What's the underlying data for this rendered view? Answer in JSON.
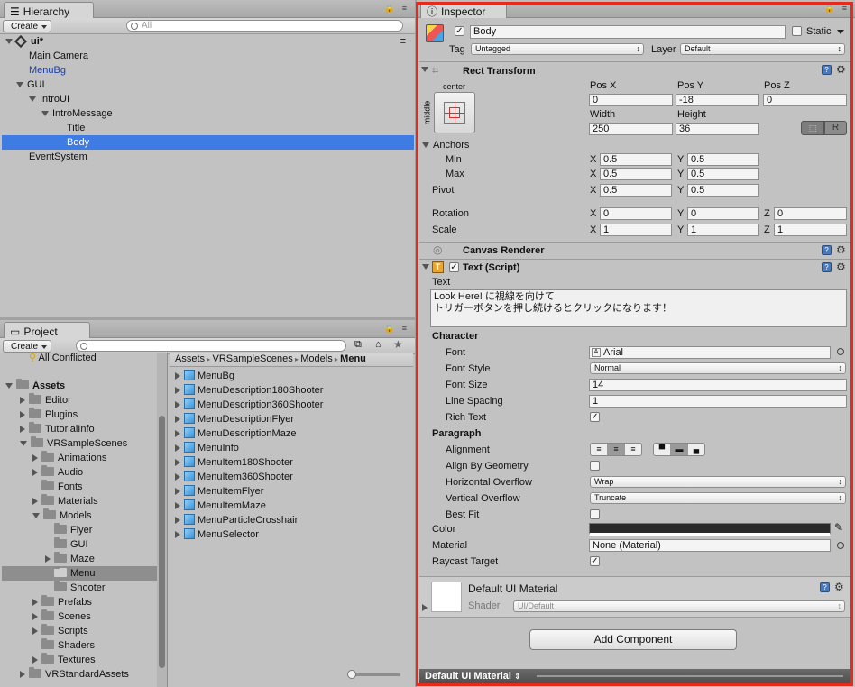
{
  "hierarchy": {
    "tab": "Hierarchy",
    "create_label": "Create",
    "search_placeholder": "All",
    "scene": "ui*",
    "items": [
      "Main Camera",
      "MenuBg",
      "GUI",
      "IntroUI",
      "IntroMessage",
      "Title",
      "Body",
      "EventSystem"
    ]
  },
  "project": {
    "tab": "Project",
    "create_label": "Create",
    "tree": [
      "All Conflicted",
      "Assets",
      "Editor",
      "Plugins",
      "TutorialInfo",
      "VRSampleScenes",
      "Animations",
      "Audio",
      "Fonts",
      "Materials",
      "Models",
      "Flyer",
      "GUI",
      "Maze",
      "Menu",
      "Shooter",
      "Prefabs",
      "Scenes",
      "Scripts",
      "Shaders",
      "Textures",
      "VRStandardAssets"
    ],
    "breadcrumb": [
      "Assets",
      "VRSampleScenes",
      "Models",
      "Menu"
    ],
    "assets": [
      "MenuBg",
      "MenuDescription180Shooter",
      "MenuDescription360Shooter",
      "MenuDescriptionFlyer",
      "MenuDescriptionMaze",
      "MenuInfo",
      "MenuItem180Shooter",
      "MenuItem360Shooter",
      "MenuItemFlyer",
      "MenuItemMaze",
      "MenuParticleCrosshair",
      "MenuSelector"
    ]
  },
  "inspector": {
    "tab": "Inspector",
    "object_name": "Body",
    "static_label": "Static",
    "tag_label": "Tag",
    "tag_value": "Untagged",
    "layer_label": "Layer",
    "layer_value": "Default",
    "rect": {
      "title": "Rect Transform",
      "anchor_top": "center",
      "anchor_side": "middle",
      "posx_label": "Pos X",
      "posy_label": "Pos Y",
      "posz_label": "Pos Z",
      "posx": "0",
      "posy": "-18",
      "posz": "0",
      "width_label": "Width",
      "height_label": "Height",
      "width": "250",
      "height": "36",
      "r_label": "R",
      "anchors_label": "Anchors",
      "min_label": "Min",
      "max_label": "Max",
      "min_x": "0.5",
      "min_y": "0.5",
      "max_x": "0.5",
      "max_y": "0.5",
      "pivot_label": "Pivot",
      "pivot_x": "0.5",
      "pivot_y": "0.5",
      "rotation_label": "Rotation",
      "rot_x": "0",
      "rot_y": "0",
      "rot_z": "0",
      "scale_label": "Scale",
      "scale_x": "1",
      "scale_y": "1",
      "scale_z": "1",
      "x": "X",
      "y": "Y",
      "z": "Z"
    },
    "canvas_renderer": "Canvas Renderer",
    "text_script": {
      "title": "Text (Script)",
      "text_label": "Text",
      "text_line1": "Look Here! に視線を向けて",
      "text_line2": "トリガーボタンを押し続けるとクリックになります！",
      "character_label": "Character",
      "font_label": "Font",
      "font_value": "Arial",
      "font_style_label": "Font Style",
      "font_style_value": "Normal",
      "font_size_label": "Font Size",
      "font_size_value": "14",
      "line_spacing_label": "Line Spacing",
      "line_spacing_value": "1",
      "rich_text_label": "Rich Text",
      "paragraph_label": "Paragraph",
      "alignment_label": "Alignment",
      "align_geom_label": "Align By Geometry",
      "h_overflow_label": "Horizontal Overflow",
      "h_overflow_value": "Wrap",
      "v_overflow_label": "Vertical Overflow",
      "v_overflow_value": "Truncate",
      "best_fit_label": "Best Fit",
      "color_label": "Color",
      "color_value": "#2a2a2a",
      "material_label": "Material",
      "material_value": "None (Material)",
      "raycast_label": "Raycast Target"
    },
    "material": {
      "name": "Default UI Material",
      "shader_label": "Shader",
      "shader_value": "UI/Default"
    },
    "add_component": "Add Component",
    "preview_label": "Default UI Material"
  },
  "colors": {
    "highlight": "#e8291c",
    "selection": "#3e7ce3"
  }
}
